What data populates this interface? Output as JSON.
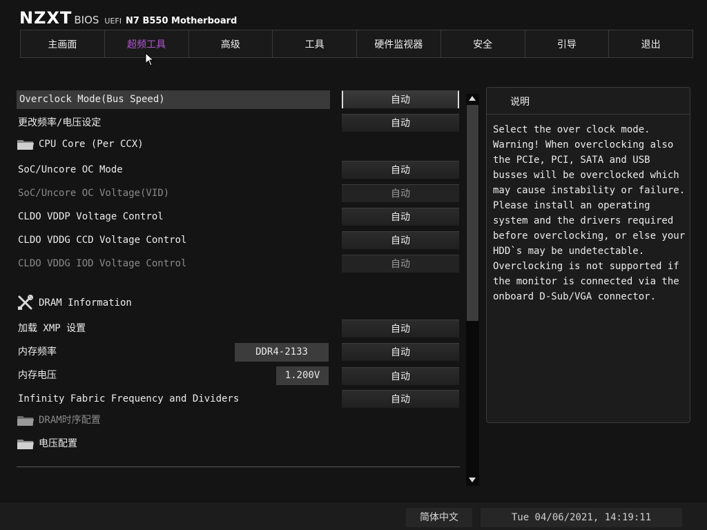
{
  "header": {
    "brand": "NZXT",
    "bios": "BIOS",
    "uefi": "UEFI",
    "board": "N7 B550 Motherboard"
  },
  "tabs": [
    {
      "label": "主画面",
      "active": false
    },
    {
      "label": "超频工具",
      "active": true
    },
    {
      "label": "高级",
      "active": false
    },
    {
      "label": "工具",
      "active": false
    },
    {
      "label": "硬件监视器",
      "active": false
    },
    {
      "label": "安全",
      "active": false
    },
    {
      "label": "引导",
      "active": false
    },
    {
      "label": "退出",
      "active": false
    }
  ],
  "settings": {
    "overclock_mode": {
      "label": "Overclock Mode(Bus Speed)",
      "value": "自动"
    },
    "freq_voltage": {
      "label": "更改频率/电压设定",
      "value": "自动"
    },
    "cpu_core": {
      "label": "CPU Core (Per CCX)"
    },
    "soc_oc_mode": {
      "label": "SoC/Uncore OC Mode",
      "value": "自动"
    },
    "soc_oc_voltage": {
      "label": "SoC/Uncore OC Voltage(VID)",
      "value": "自动"
    },
    "cldo_vddp": {
      "label": "CLDO VDDP Voltage Control",
      "value": "自动"
    },
    "cldo_vddg_ccd": {
      "label": "CLDO VDDG CCD Voltage Control",
      "value": "自动"
    },
    "cldo_vddg_iod": {
      "label": "CLDO VDDG IOD Voltage Control",
      "value": "自动"
    },
    "dram_info": {
      "label": "DRAM Information"
    },
    "xmp": {
      "label": "加载 XMP 设置",
      "value": "自动"
    },
    "mem_freq": {
      "label": "内存频率",
      "current": "DDR4-2133",
      "value": "自动"
    },
    "mem_voltage": {
      "label": "内存电压",
      "current": "1.200V",
      "value": "自动"
    },
    "infinity_fabric": {
      "label": "Infinity Fabric Frequency and Dividers",
      "value": "自动"
    },
    "dram_timing": {
      "label": "DRAM时序配置"
    },
    "voltage_config": {
      "label": "电压配置"
    }
  },
  "help": {
    "title": "说明",
    "text": "Select the over clock mode.\nWarning! When overclocking also\nthe PCIe, PCI, SATA and USB\nbusses will be overclocked which\nmay cause instability or failure.\nPlease install an operating\nsystem and the drivers required\nbefore overclocking, or else your\nHDD`s may be undetectable.\nOverclocking is not supported if\nthe monitor is connected via the\nonboard D-Sub/VGA connector."
  },
  "footer": {
    "language": "简体中文",
    "datetime": "Tue 04/06/2021, 14:19:11"
  },
  "colors": {
    "background": "#141414",
    "active_tab": "#b355d1",
    "disabled_text": "#8a8a8a",
    "value_box": "#3c3c3c"
  },
  "icons": {
    "folder": "folder-icon",
    "tools": "wrench-screwdriver-icon",
    "cursor": "mouse-pointer-icon"
  }
}
